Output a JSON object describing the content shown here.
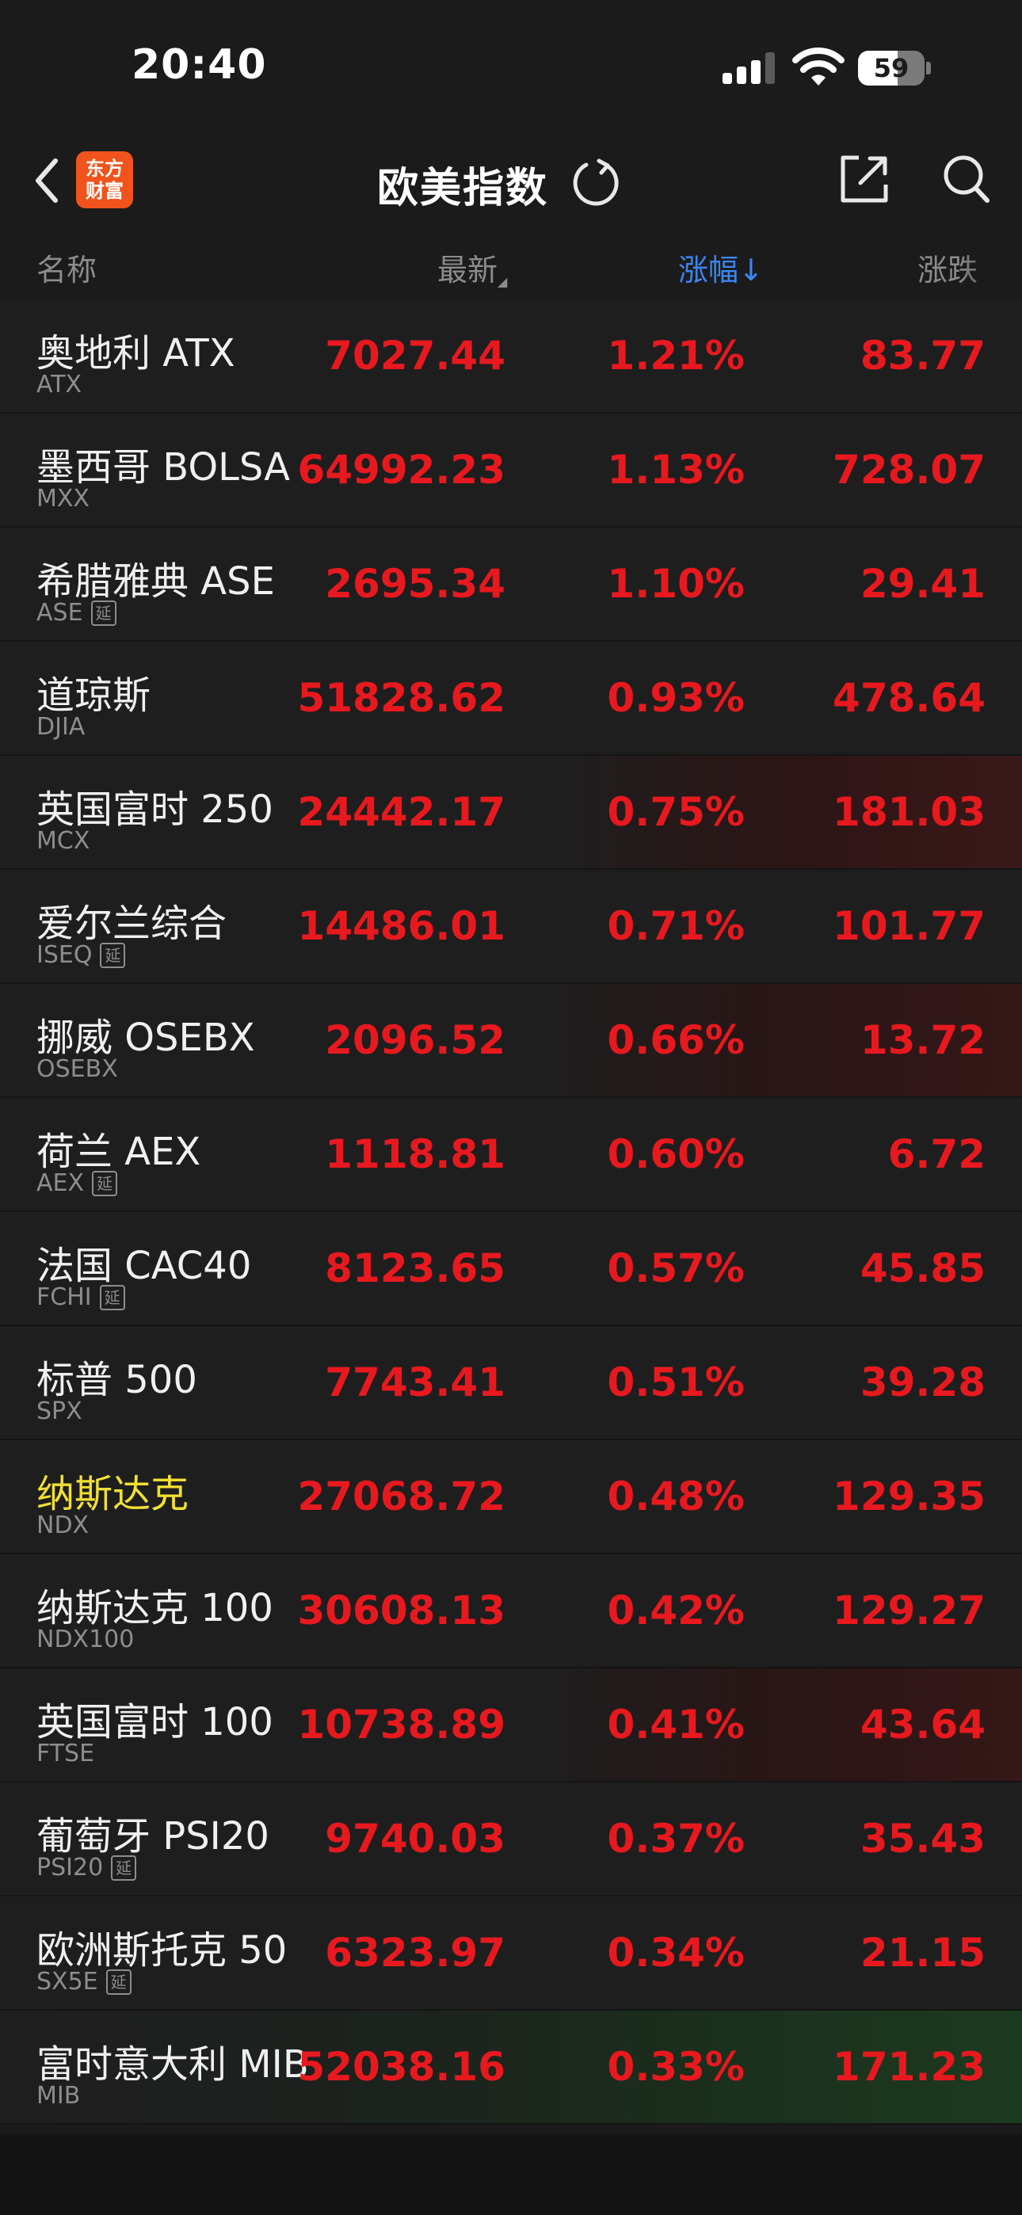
{
  "status": {
    "time": "20:40",
    "battery": "59",
    "battery_level": 0.59
  },
  "nav": {
    "logo_line1": "东方",
    "logo_line2": "财富",
    "title": "欧美指数"
  },
  "columns": {
    "name": "名称",
    "latest": "最新",
    "pct": "涨幅↓",
    "chg": "涨跌"
  },
  "rows": [
    {
      "name": "奥地利 ATX",
      "code": "ATX",
      "delayed": false,
      "latest": "7027.44",
      "pct": "1.21%",
      "chg": "83.77"
    },
    {
      "name": "墨西哥 BOLSA",
      "code": "MXX",
      "delayed": false,
      "latest": "64992.23",
      "pct": "1.13%",
      "chg": "728.07"
    },
    {
      "name": "希腊雅典 ASE",
      "code": "ASE",
      "delayed": true,
      "latest": "2695.34",
      "pct": "1.10%",
      "chg": "29.41"
    },
    {
      "name": "道琼斯",
      "code": "DJIA",
      "delayed": false,
      "latest": "51828.62",
      "pct": "0.93%",
      "chg": "478.64"
    },
    {
      "name": "英国富时 250",
      "code": "MCX",
      "delayed": false,
      "latest": "24442.17",
      "pct": "0.75%",
      "chg": "181.03"
    },
    {
      "name": "爱尔兰综合",
      "code": "ISEQ",
      "delayed": true,
      "latest": "14486.01",
      "pct": "0.71%",
      "chg": "101.77"
    },
    {
      "name": "挪威 OSEBX",
      "code": "OSEBX",
      "delayed": false,
      "latest": "2096.52",
      "pct": "0.66%",
      "chg": "13.72"
    },
    {
      "name": "荷兰 AEX",
      "code": "AEX",
      "delayed": true,
      "latest": "1118.81",
      "pct": "0.60%",
      "chg": "6.72"
    },
    {
      "name": "法国 CAC40",
      "code": "FCHI",
      "delayed": true,
      "latest": "8123.65",
      "pct": "0.57%",
      "chg": "45.85"
    },
    {
      "name": "标普 500",
      "code": "SPX",
      "delayed": false,
      "latest": "7743.41",
      "pct": "0.51%",
      "chg": "39.28"
    },
    {
      "name": "纳斯达克",
      "code": "NDX",
      "delayed": false,
      "latest": "27068.72",
      "pct": "0.48%",
      "chg": "129.35"
    },
    {
      "name": "纳斯达克 100",
      "code": "NDX100",
      "delayed": false,
      "latest": "30608.13",
      "pct": "0.42%",
      "chg": "129.27"
    },
    {
      "name": "英国富时 100",
      "code": "FTSE",
      "delayed": false,
      "latest": "10738.89",
      "pct": "0.41%",
      "chg": "43.64"
    },
    {
      "name": "葡萄牙 PSI20",
      "code": "PSI20",
      "delayed": true,
      "latest": "9740.03",
      "pct": "0.37%",
      "chg": "35.43"
    },
    {
      "name": "欧洲斯托克 50",
      "code": "SX5E",
      "delayed": true,
      "latest": "6323.97",
      "pct": "0.34%",
      "chg": "21.15"
    },
    {
      "name": "富时意大利 MIB",
      "code": "MIB",
      "delayed": false,
      "latest": "52038.16",
      "pct": "0.33%",
      "chg": "171.23"
    }
  ],
  "delay_label": "延",
  "colors": {
    "up": "#e8191e",
    "accent": "#3b86f0",
    "highlight": "#f2e033",
    "logo": "#f0541c"
  }
}
